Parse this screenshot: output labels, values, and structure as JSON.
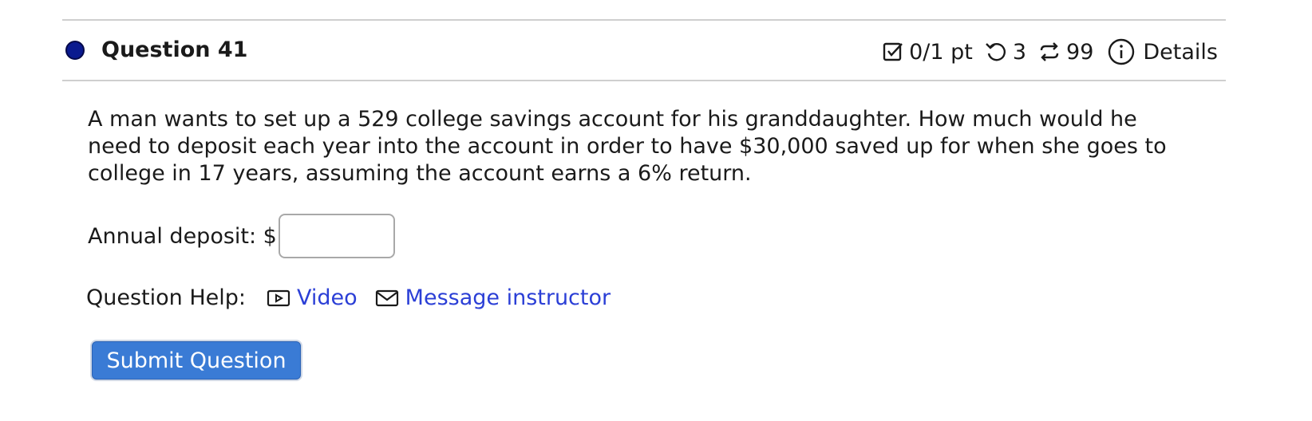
{
  "question": {
    "title": "Question 41",
    "status_color": "#0a1a8f",
    "score": "0/1 pt",
    "retries": "3",
    "attempts": "99",
    "details_label": "Details",
    "text": "A man wants to set up a 529 college savings account for his granddaughter. How much would he need to deposit each year into the account in order to have $30,000 saved up for when she goes to college in 17 years, assuming the account earns a 6% return."
  },
  "answer": {
    "label": "Annual deposit: $",
    "value": ""
  },
  "help": {
    "label": "Question Help:",
    "links": [
      {
        "label": "Video",
        "icon": "video-icon"
      },
      {
        "label": "Message instructor",
        "icon": "mail-icon"
      }
    ]
  },
  "submit": {
    "label": "Submit Question",
    "color": "#3a7bd5"
  }
}
